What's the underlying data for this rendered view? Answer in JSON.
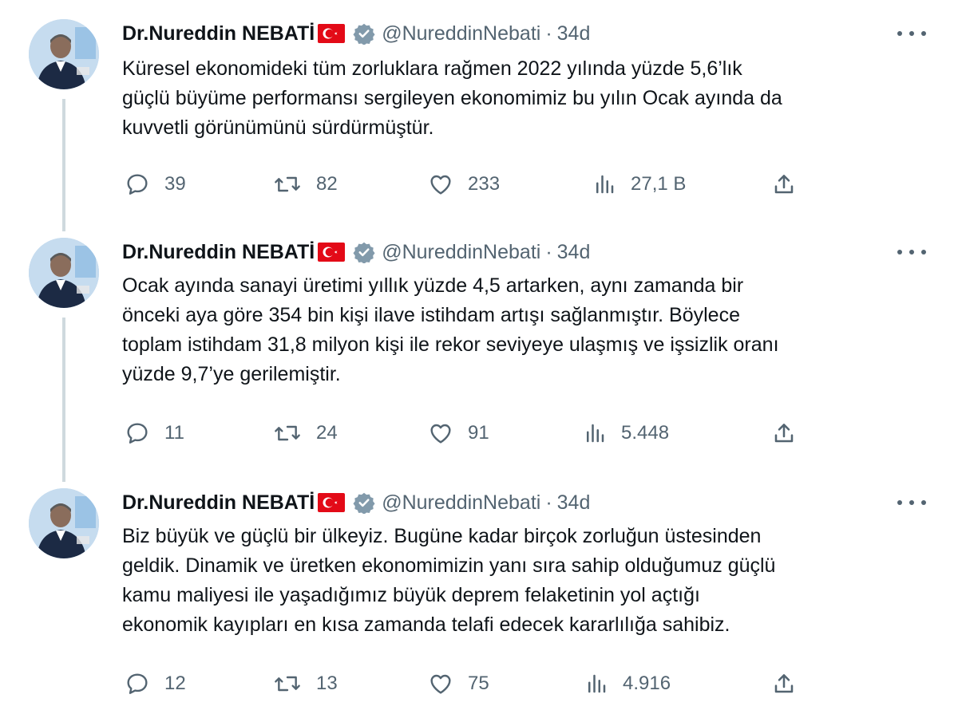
{
  "author": {
    "name": "Dr.Nureddin NEBATİ",
    "handle": "@NureddinNebati",
    "separator": "·",
    "time": "34d"
  },
  "colors": {
    "text": "#0f1419",
    "secondary": "#536471",
    "thread_line": "#cfd9de",
    "verified": "#829aab",
    "flag_red": "#e30a17"
  },
  "icons": [
    "flag-turkey-icon",
    "verified-badge-icon",
    "more-icon",
    "reply-icon",
    "retweet-icon",
    "like-icon",
    "views-icon",
    "share-icon"
  ],
  "tweets": [
    {
      "lines": [
        "Küresel ekonomideki tüm zorluklara rağmen 2022 yılında yüzde 5,6’lık",
        "güçlü büyüme performansı sergileyen ekonomimiz bu yılın Ocak ayında da",
        "kuvvetli görünümünü sürdürmüştür."
      ],
      "replies": "39",
      "retweets": "82",
      "likes": "233",
      "views": "27,1 B"
    },
    {
      "lines": [
        "Ocak ayında sanayi üretimi yıllık yüzde 4,5 artarken, aynı zamanda bir",
        "önceki aya göre 354 bin kişi ilave istihdam artışı sağlanmıştır. Böylece",
        "toplam istihdam 31,8 milyon kişi ile rekor seviyeye ulaşmış ve işsizlik oranı",
        "yüzde 9,7’ye gerilemiştir."
      ],
      "replies": "11",
      "retweets": "24",
      "likes": "91",
      "views": "5.448"
    },
    {
      "lines": [
        "Biz büyük ve güçlü bir ülkeyiz. Bugüne kadar birçok zorluğun üstesinden",
        "geldik. Dinamik ve üretken ekonomimizin yanı sıra sahip olduğumuz güçlü",
        "kamu maliyesi ile yaşadığımız büyük deprem felaketinin yol açtığı",
        "ekonomik kayıpları en kısa zamanda telafi edecek kararlılığa sahibiz."
      ],
      "replies": "12",
      "retweets": "13",
      "likes": "75",
      "views": "4.916"
    }
  ]
}
